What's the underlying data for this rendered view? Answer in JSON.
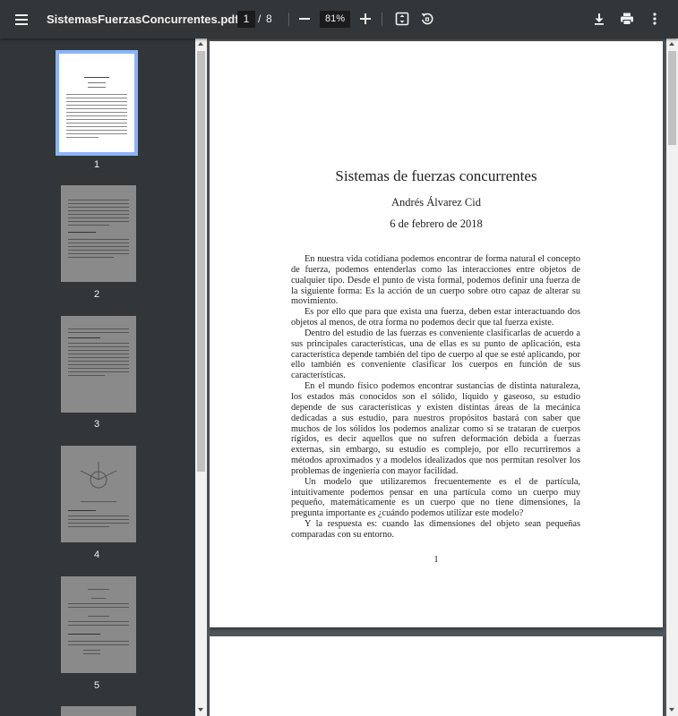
{
  "toolbar": {
    "filename": "SistemasFuerzasConcurrentes.pdf",
    "current_page": "1",
    "page_separator": "/",
    "total_pages": "8",
    "zoom": "81%"
  },
  "sidebar": {
    "thumbnails": [
      {
        "label": "1"
      },
      {
        "label": "2"
      },
      {
        "label": "3"
      },
      {
        "label": "4"
      },
      {
        "label": "5"
      }
    ]
  },
  "document": {
    "title": "Sistemas de fuerzas concurrentes",
    "author": "Andrés Álvarez Cid",
    "date": "6 de febrero de 2018",
    "paragraphs": [
      "En nuestra vida cotidiana podemos encontrar de forma natural el concepto de fuerza, podemos entenderlas como las interacciones entre objetos de cualquier tipo. Desde el punto de vista formal, podemos definir una fuerza de la siguiente forma: Es la acción de un cuerpo sobre otro capaz de alterar su movimiento.",
      "Es por ello que para que exista una fuerza, deben estar interactuando dos objetos al menos, de otra forma no podemos decir que tal fuerza existe.",
      "Dentro del estudio de las fuerzas es conveniente clasificarlas de acuerdo a sus principales características, una de ellas es su punto de aplicación, esta característica depende también del tipo de cuerpo al que se esté aplicando, por ello también es conveniente clasificar los cuerpos en función de sus características.",
      "En el mundo físico podemos encontrar sustancias de distinta naturaleza, los estados más conocidos son el sólido, líquido y gaseoso, su estudio depende de sus características y existen distintas áreas de la mecánica dedicadas a sus estudio, para nuestros propósitos bastará con saber que muchos de los sólidos los podemos analizar como si se trataran de cuerpos rígidos, es decir aquellos que no sufren deformación debida a fuerzas externas, sin embargo, su estudio es complejo, por ello recurriremos a métodos aproximados y a modelos idealizados que nos permitan resolver los problemas de ingeniería con mayor facilidad.",
      "Un modelo que utilizaremos frecuentemente es el de partícula, intuitivamente podemos pensar en una partícula como un cuerpo muy pequeño, matemáticamente es un cuerpo que no tiene dimensiones, la pregunta importante es ¿cuándo podemos utilizar este modelo?",
      "Y la respuesta es: cuando las dimensiones del objeto sean pequeñas comparadas con su entorno."
    ],
    "page_number": "1"
  }
}
